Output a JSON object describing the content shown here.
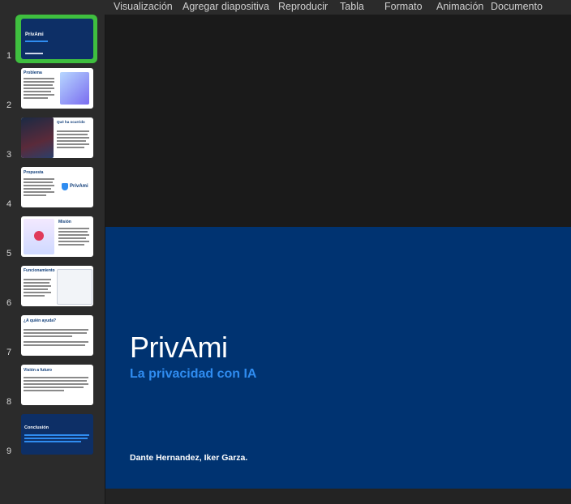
{
  "menu": [
    "Visualización",
    "Agregar diapositiva",
    "Reproducir",
    "Tabla",
    "Formato",
    "Animación",
    "Documento"
  ],
  "slides": [
    {
      "num": "1",
      "title": "PrivAmi"
    },
    {
      "num": "2",
      "title": "Problema"
    },
    {
      "num": "3",
      "title": "Qué ha ocurrido"
    },
    {
      "num": "4",
      "title": "Propuesta"
    },
    {
      "num": "5",
      "title": "Misión"
    },
    {
      "num": "6",
      "title": "Funcionamiento"
    },
    {
      "num": "7",
      "title": "¿A quién ayuda?"
    },
    {
      "num": "8",
      "title": "Visión a futuro"
    },
    {
      "num": "9",
      "title": "Conclusión"
    }
  ],
  "main_slide": {
    "title": "PrivAmi",
    "subtitle": "La privacidad con IA",
    "authors": "Dante Hernandez, Iker Garza."
  },
  "colors": {
    "selection": "#3fbf3f",
    "slide_bg": "#003371",
    "accent": "#2f8cf0"
  }
}
